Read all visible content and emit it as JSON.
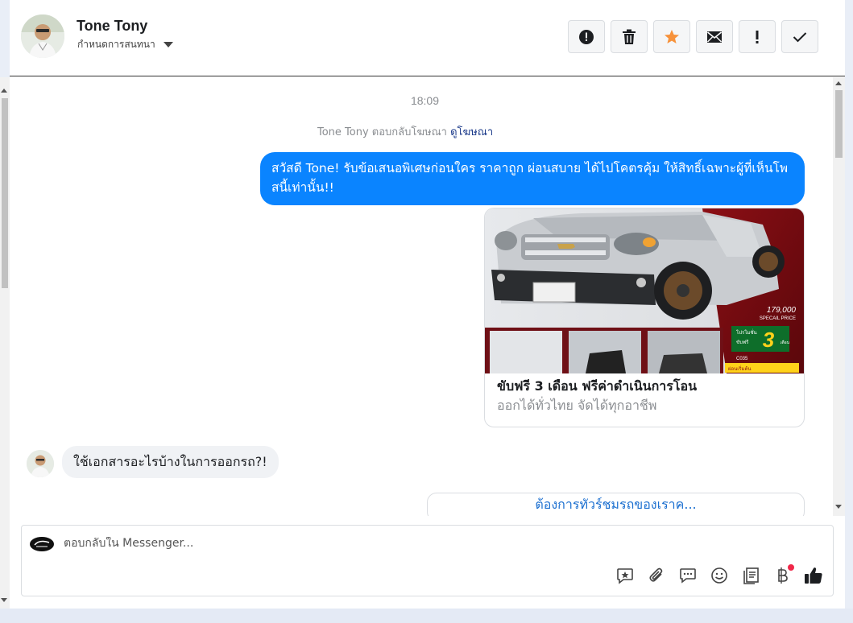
{
  "header": {
    "name": "Tone Tony",
    "subtitle": "กำหนดการสนทนา"
  },
  "toolbar": {
    "buttons": [
      {
        "icon": "alert-circle-icon"
      },
      {
        "icon": "trash-icon"
      },
      {
        "icon": "star-icon",
        "color": "#f7923b"
      },
      {
        "icon": "envelope-icon"
      },
      {
        "icon": "exclamation-icon"
      },
      {
        "icon": "check-icon"
      }
    ]
  },
  "chat": {
    "timestamp": "18:09",
    "reply_note": "Tone Tony ตอบกลับโฆษณา",
    "reply_link": "ดูโฆษณา",
    "outgoing_message": "สวัสดี Tone! รับข้อเสนอพิเศษก่อนใคร ราคาถูก ผ่อนสบาย ได้ไปโคตรคุ้ม ให้สิทธิ์เฉพาะผู้ที่เห็นโพสนี้เท่านั้น!!",
    "card": {
      "title": "ขับฟรี 3 เดือน ฟรีค่าดำเนินการโอน",
      "subtitle": "ออกได้ทั่วไทย จัดได้ทุกอาชีพ",
      "image_price": "179,000",
      "image_price_label": "SPECAIL PRICE",
      "image_promo_small": "โปรโมชั่น",
      "image_promo_free": "ขับฟรี",
      "image_promo_number": "3",
      "image_promo_unit": "เดือน",
      "image_code": "C035",
      "image_down": "ผ่อนเริ่มต้น"
    },
    "incoming_message": "ใช้เอกสารอะไรบ้างในการออกรถ?!",
    "quick_reply": "ต้องการทัวร์ชมรถของเราค..."
  },
  "composer": {
    "placeholder": "ตอบกลับใน Messenger...",
    "tools": [
      "saved-reply-icon",
      "paperclip-icon",
      "chat-bubble-icon",
      "emoji-icon",
      "notes-icon",
      "baht-icon",
      "thumbs-up-icon"
    ]
  },
  "colors": {
    "accent": "#0a84ff",
    "link": "#1b3a8a",
    "quick_reply": "#1b6fd0",
    "star": "#f7923b",
    "notification": "#f02849"
  }
}
